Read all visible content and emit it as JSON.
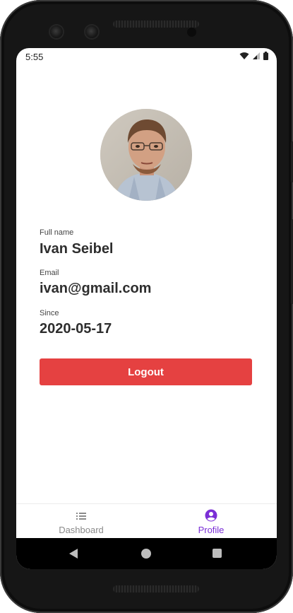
{
  "status_bar": {
    "time": "5:55",
    "icons": [
      "wifi-icon",
      "signal-icon",
      "battery-icon"
    ]
  },
  "profile": {
    "avatar_alt": "profile photo",
    "full_name_label": "Full name",
    "full_name": "Ivan Seibel",
    "email_label": "Email",
    "email": "ivan@gmail.com",
    "since_label": "Since",
    "since": "2020-05-17",
    "logout_label": "Logout"
  },
  "tabs": [
    {
      "label": "Dashboard",
      "icon": "list-icon",
      "active": false
    },
    {
      "label": "Profile",
      "icon": "user-circle-icon",
      "active": true
    }
  ],
  "colors": {
    "accent": "#7b2fd6",
    "logout": "#e54141",
    "text": "#2e2e2e"
  }
}
